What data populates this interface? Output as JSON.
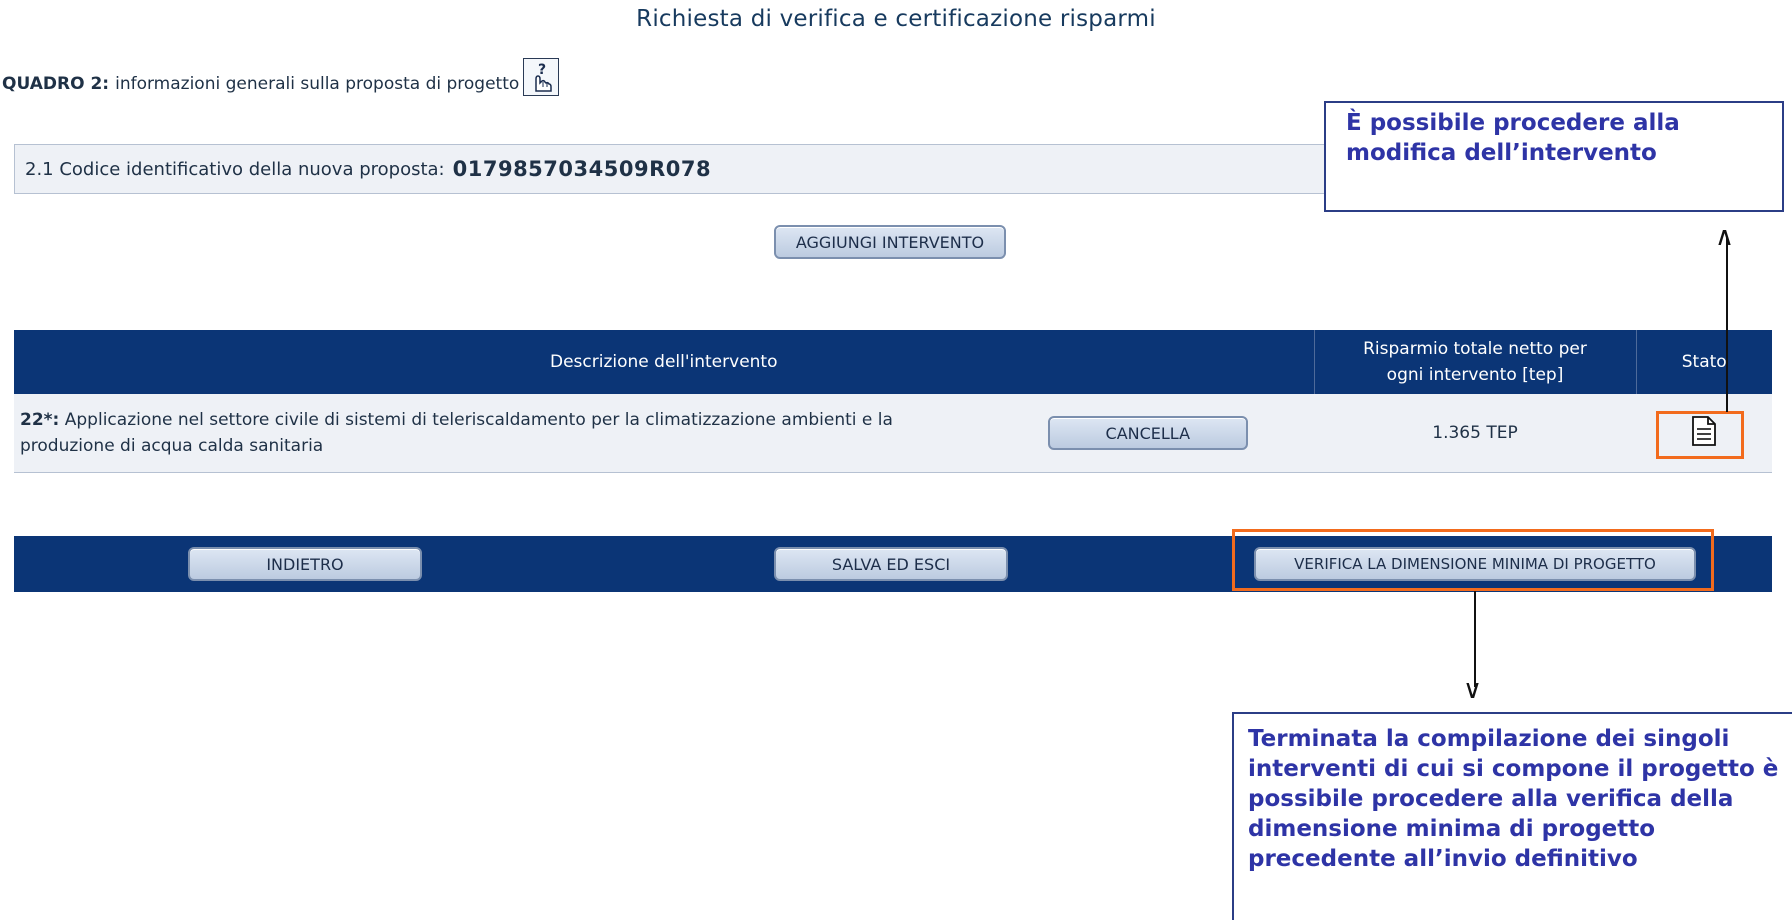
{
  "page_title": "Richiesta di verifica e certificazione risparmi",
  "quadro": {
    "prefix": "QUADRO 2:",
    "text": "informazioni generali sulla proposta di progetto",
    "help_icon": "help-hand-icon"
  },
  "proposal": {
    "label": "2.1 Codice identificativo della nuova proposta:",
    "code": "0179857034509R078"
  },
  "buttons": {
    "add_intervention": "AGGIUNGI INTERVENTO",
    "delete": "CANCELLA",
    "back": "INDIETRO",
    "save_exit": "SALVA ED ESCI",
    "verify": "VERIFICA LA DIMENSIONE MINIMA DI PROGETTO"
  },
  "table": {
    "headers": {
      "description": "Descrizione dell'intervento",
      "savings_line1": "Risparmio totale netto per",
      "savings_line2": "ogni intervento [tep]",
      "status": "Stato"
    },
    "rows": [
      {
        "code": "22*:",
        "description": "Applicazione nel settore civile di sistemi di teleriscaldamento per la climatizzazione ambienti e la produzione di acqua calda sanitaria",
        "savings": "1.365 TEP",
        "status_icon": "document-icon"
      }
    ]
  },
  "callouts": {
    "edit": "È possibile procedere alla modifica dell’intervento",
    "verify": "Terminata la compilazione dei singoli interventi di cui si compone il progetto è possibile procedere alla verifica della dimensione minima di progetto precedente all’invio definitivo"
  },
  "colors": {
    "header_blue": "#0b3576",
    "callout_text": "#2e34a6",
    "highlight_orange": "#f26b1d",
    "row_bg": "#eef1f6"
  }
}
